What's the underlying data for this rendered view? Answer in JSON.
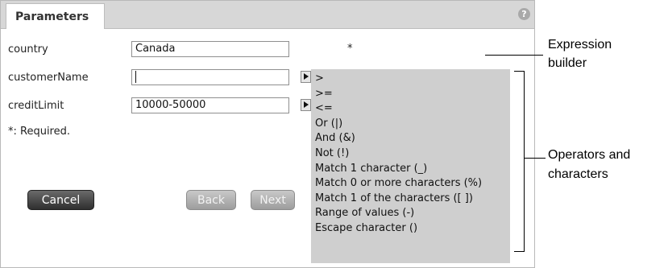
{
  "header": {
    "tab_label": "Parameters",
    "help_icon": "?"
  },
  "fields": [
    {
      "label": "country",
      "value": "Canada"
    },
    {
      "label": "customerName",
      "value": ""
    },
    {
      "label": "creditLimit",
      "value": "10000-50000"
    }
  ],
  "required_marker": "*",
  "required_note": "*: Required.",
  "buttons": {
    "cancel": "Cancel",
    "back": "Back",
    "next": "Next"
  },
  "operators_menu": [
    ">",
    ">=",
    "<=",
    "Or (|)",
    "And (&)",
    "Not (!)",
    "Match 1 character (_)",
    "Match 0 or more characters (%)",
    "Match 1 of the characters ([ ])",
    "Range of values (-)",
    "Escape character ()"
  ],
  "annotations": {
    "expression_builder_1": "Expression",
    "expression_builder_2": "builder",
    "operators_1": "Operators and",
    "operators_2": "characters"
  },
  "colors": {
    "menu_bg": "#cfcfcf",
    "header_bg": "#d7d7d7",
    "dark_button": "#3a3a3a"
  }
}
